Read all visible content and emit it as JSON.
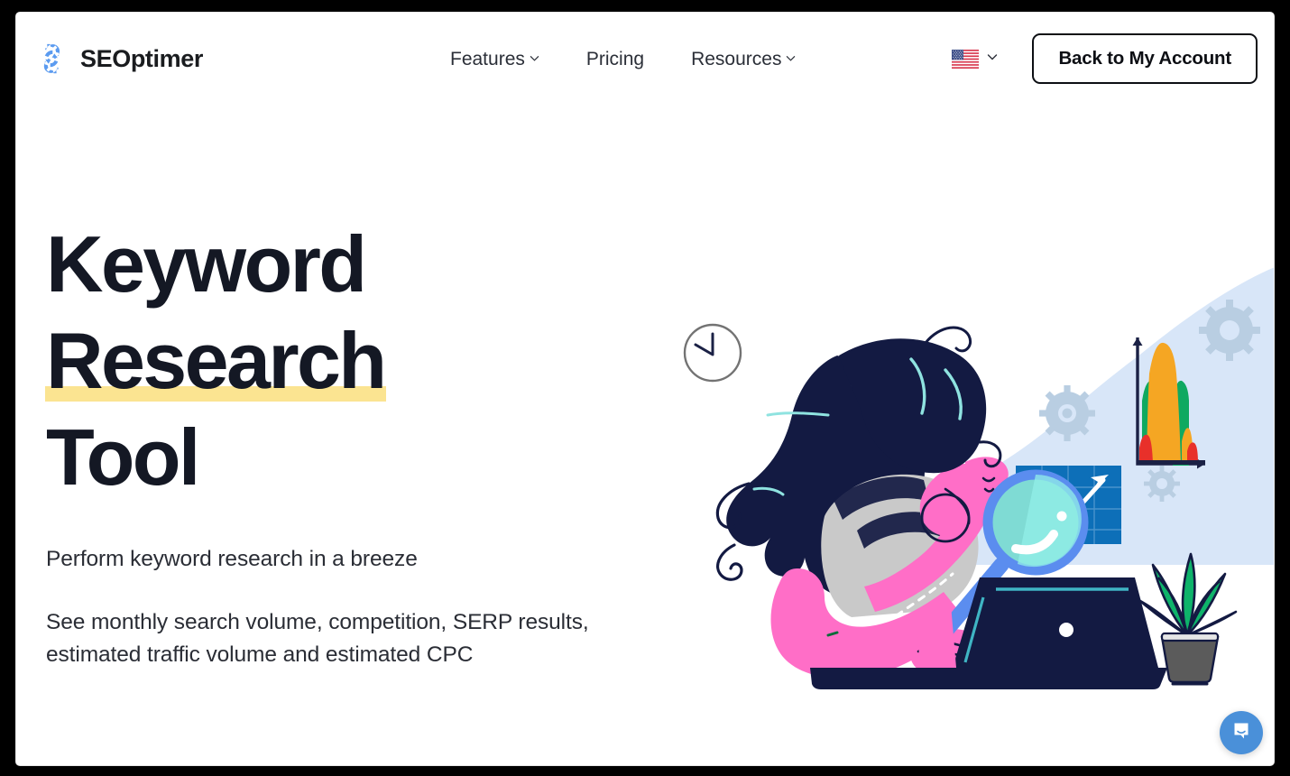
{
  "brand": {
    "name": "SEOptimer",
    "logo_icon": "gear-s-logo-icon",
    "accent_blue": "#5b9bf0",
    "text_dark": "#141824"
  },
  "header": {
    "nav": [
      {
        "label": "Features",
        "has_dropdown": true,
        "icon": "chevron-down-icon"
      },
      {
        "label": "Pricing",
        "has_dropdown": false,
        "icon": ""
      },
      {
        "label": "Resources",
        "has_dropdown": true,
        "icon": "chevron-down-icon"
      }
    ],
    "language": {
      "label": "United States",
      "icon": "us-flag-icon",
      "chevron": "chevron-down-icon"
    },
    "account_button": {
      "label": "Back to My Account"
    }
  },
  "hero": {
    "title_line1": "Keyword",
    "title_line2": "Research",
    "title_line3": "Tool",
    "highlight_word": "Research",
    "highlight_color": "#fbe491",
    "subtitle": "Perform keyword research in a breeze",
    "description": "See monthly search volume, competition, SERP results, estimated traffic volume and estimated CPC",
    "illustration": {
      "name": "woman-with-magnifier-at-laptop-illustration",
      "elements": [
        "clock-icon",
        "woman-figure",
        "magnifying-glass-icon",
        "laptop-icon",
        "line-chart-panel-icon",
        "area-chart-icon",
        "gear-icon",
        "potted-plant-icon"
      ],
      "colors": {
        "hair": "#131a42",
        "skin": "#ff6ec7",
        "shirt": "#c9c9c9",
        "lens": "#7fdbd4",
        "lens_ring": "#5b8def",
        "blob": "#d5e4f7",
        "chart_panel": "#0d6fb8",
        "plant_green": "#0eb36a",
        "pot": "#5b5b5b",
        "gear": "#b9cee2",
        "area_orange": "#f5a623",
        "area_green": "#0fa960",
        "area_red": "#e8302a"
      }
    }
  },
  "support": {
    "chat_button": {
      "icon": "chat-bubble-icon",
      "label": "Open chat"
    }
  }
}
